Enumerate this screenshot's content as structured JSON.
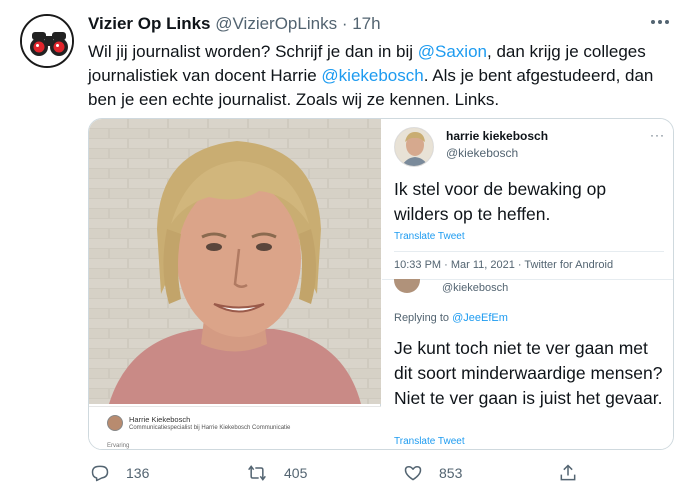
{
  "tweet": {
    "author_name": "Vizier Op Links",
    "author_handle": "@VizierOpLinks",
    "separator": "·",
    "time": "17h",
    "text_part1": "Wil jij journalist worden? Schrijf je dan in bij ",
    "mention1": "@Saxion",
    "text_part2": ", dan krijg je colleges journalistiek van docent Harrie ",
    "mention2": "@kiekebosch",
    "text_part3": ". Als je bent afgestudeerd, dan ben je een echte journalist. Zoals wij ze kennen. Links."
  },
  "card": {
    "name": "Harrie Kiekebosch",
    "subtitle": "Communicatiespecialist bij Harrie Kiekebosch Communicatie",
    "extra": "Ervaring"
  },
  "quoted": {
    "name": "harrie kiekebosch",
    "handle": "@kiekebosch",
    "more": "···",
    "text": "Ik stel voor de bewaking op wilders op te heffen.",
    "translate": "Translate Tweet",
    "date": "10:33 PM · Mar 11, 2021 · Twitter for Android",
    "cropped_handle": "@kiekebosch",
    "replying_label": "Replying to ",
    "replying_to": "@JeeEfEm",
    "reply_text": "Je kunt toch niet te ver gaan met dit soort minderwaardige mensen? Niet te ver gaan is juist het gevaar.",
    "reply_translate": "Translate Tweet"
  },
  "actions": {
    "replies": "136",
    "retweets": "405",
    "likes": "853"
  },
  "colors": {
    "link": "#1d9bf0",
    "text": "#0f1419",
    "muted": "#536471",
    "border": "#cfd9de"
  }
}
